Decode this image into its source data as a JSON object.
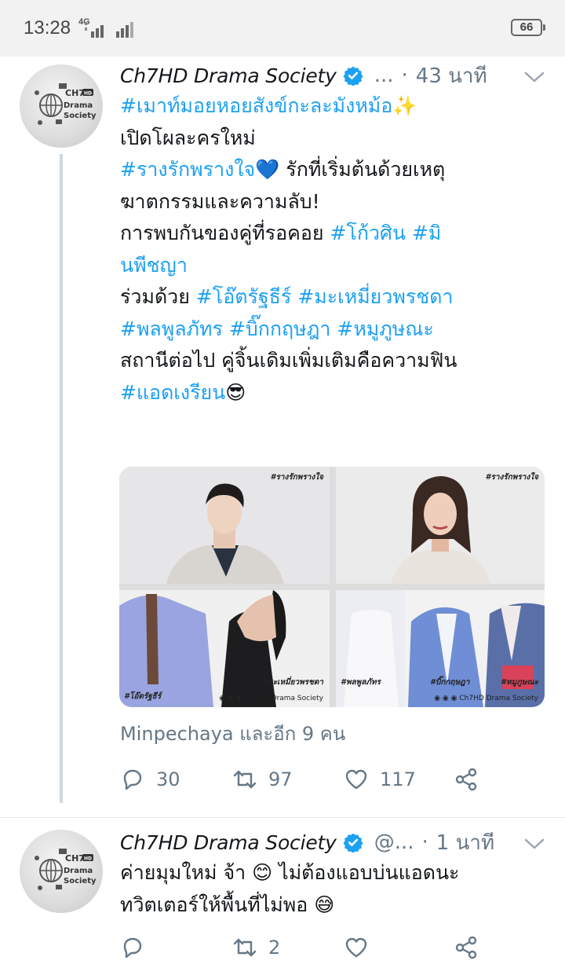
{
  "status_bar": {
    "time": "13:28",
    "network": "4G",
    "battery": "66"
  },
  "tweets": [
    {
      "author_name": "Ch7HD Drama Society",
      "handle": "...",
      "time_ago": "43 นาที",
      "lines": [
        [
          {
            "t": "#เมาท์มอยหอยสังข์กะละมังหม้อ",
            "tag": true
          },
          {
            "t": "✨",
            "tag": false
          }
        ],
        [
          {
            "t": " ",
            "tag": false
          }
        ],
        [
          {
            "t": "เปิดโผละครใหม่",
            "tag": false
          }
        ],
        [
          {
            "t": "#รางรักพรางใจ",
            "tag": true
          },
          {
            "t": "💙  รักที่เริ่มต้นด้วยเหตุ",
            "tag": false
          }
        ],
        [
          {
            "t": "ฆาตกรรมและความลับ!",
            "tag": false
          }
        ],
        [
          {
            "t": "การพบกันของคู่ที่รอคอย  ",
            "tag": false
          },
          {
            "t": "#โก้วศิน",
            "tag": true
          },
          {
            "t": " ",
            "tag": false
          },
          {
            "t": "#มิ",
            "tag": true
          }
        ],
        [
          {
            "t": "นพีชญา",
            "tag": true
          }
        ],
        [
          {
            "t": "ร่วมด้วย  ",
            "tag": false
          },
          {
            "t": "#โอ๊ตรัฐธีร์",
            "tag": true
          },
          {
            "t": " ",
            "tag": false
          },
          {
            "t": "#มะเหมี่ยวพรชดา",
            "tag": true
          }
        ],
        [
          {
            "t": "#พลพูลภัทร",
            "tag": true
          },
          {
            "t": "  ",
            "tag": false
          },
          {
            "t": "#บิ๊กกฤษฎา",
            "tag": true
          },
          {
            "t": "  ",
            "tag": false
          },
          {
            "t": "#หมูภูษณะ",
            "tag": true
          }
        ],
        [
          {
            "t": " ",
            "tag": false
          }
        ],
        [
          {
            "t": "สถานีต่อไป  คู่จิ้นเดิมเพิ่มเติมคือความฟิน",
            "tag": false
          }
        ],
        [
          {
            "t": "#แอดเงรียน",
            "tag": true
          },
          {
            "t": "😎",
            "tag": false
          }
        ]
      ],
      "media_overlays": {
        "tl": "#รางรักพรางใจ",
        "tr": "#รางรักพรางใจ",
        "bl_left": "#โอ๊ตรัฐธีร์",
        "bl_right": "#มะเหมี่ยวพรชดา",
        "bl_footer": "Ch7HD Drama Society",
        "br_left": "#พลพูลภัทร",
        "br_mid": "#บิ๊กกฤษฎา",
        "br_right": "#หมูภูษณะ",
        "br_footer": "Ch7HD Drama Society"
      },
      "liked_by": "Minpechaya และอีก 9 คน",
      "replies": "30",
      "retweets": "97",
      "likes": "117"
    },
    {
      "author_name": "Ch7HD Drama Society",
      "handle": "@...",
      "time_ago": "1 นาที",
      "lines": [
        [
          {
            "t": "ค่ายมุมใหม่  จ้า  😊  ไม่ต้องแอบบ่นแอดนะ",
            "tag": false
          }
        ],
        [
          {
            "t": "ทวิตเตอร์ให้พื้นที่ไม่พอ  😅",
            "tag": false
          }
        ]
      ],
      "replies": "",
      "retweets": "2",
      "likes": ""
    }
  ],
  "avatar_text": [
    "CH7",
    "HD",
    "Drama",
    "Society"
  ],
  "colors": {
    "link": "#1da1f2",
    "muted": "#657786",
    "verified": "#1da1f2"
  }
}
